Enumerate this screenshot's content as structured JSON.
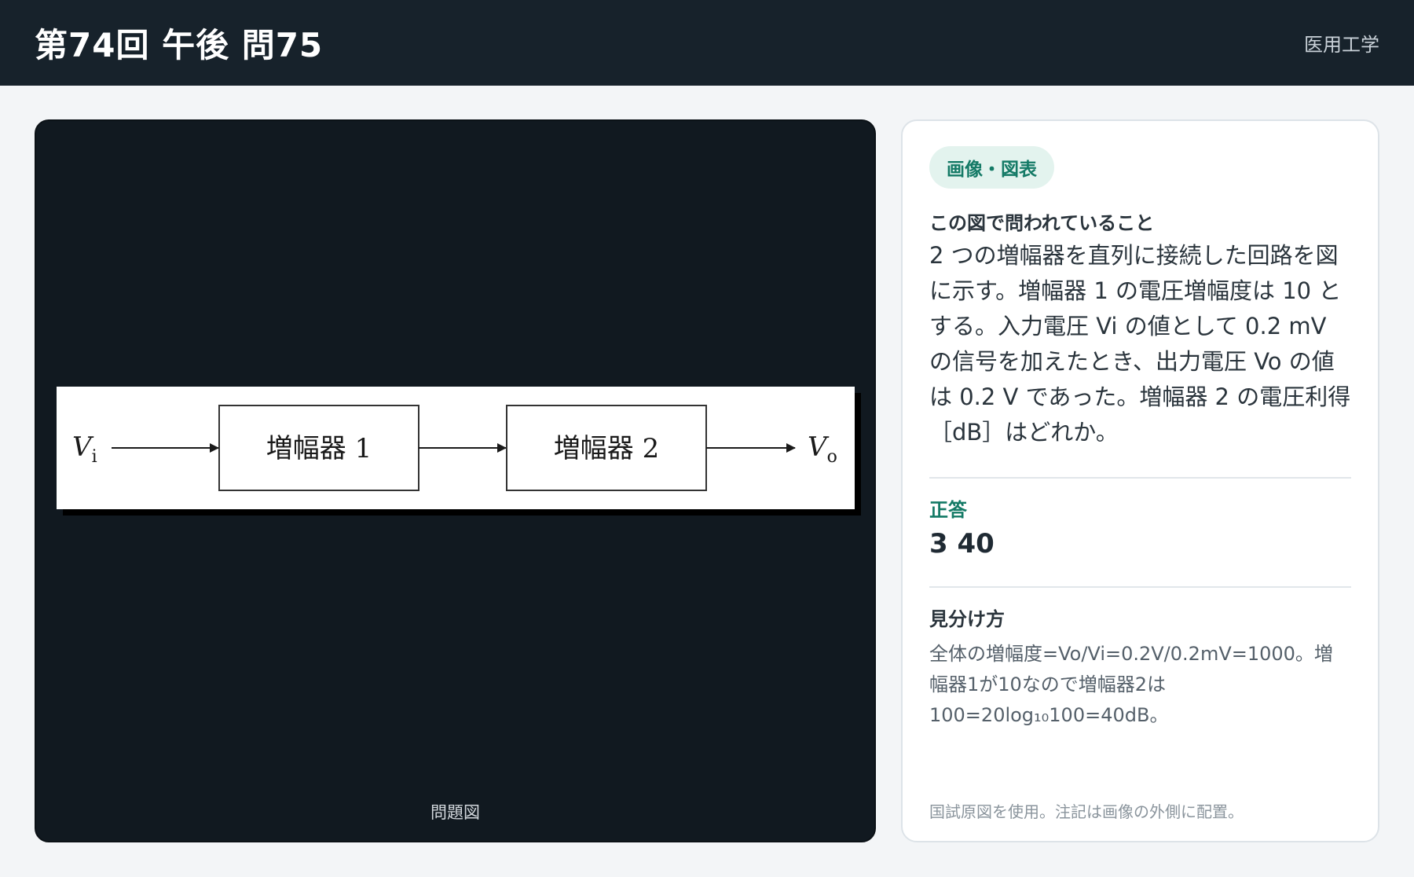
{
  "header": {
    "title": "第74回 午後 問75",
    "subject": "医用工学"
  },
  "figure": {
    "caption": "問題図",
    "diagram": {
      "input_label": "V",
      "input_sub": "i",
      "output_label": "V",
      "output_sub": "o",
      "block1": "増幅器 1",
      "block2": "増幅器 2"
    }
  },
  "card": {
    "tag": "画像・図表",
    "question_heading": "この図で問われていること",
    "question_body": "2 つの増幅器を直列に接続した回路を図に示す。増幅器 1 の電圧増幅度は 10 とする。入力電圧 Vi の値として 0.2 mV の信号を加えたとき、出力電圧 Vo の値は 0.2 V であった。増幅器 2 の電圧利得［dB］はどれか。",
    "answer_label": "正答",
    "answer_value": "3 40",
    "tip_label": "見分け方",
    "tip_body": "全体の増幅度=Vo/Vi=0.2V/0.2mV=1000。増幅器1が10なので増幅器2は100=20log₁₀100=40dB。",
    "footnote": "国試原図を使用。注記は画像の外側に配置。"
  },
  "colors": {
    "header_bg": "#17222b",
    "panel_bg": "#111920",
    "accent": "#147a66",
    "tag_bg": "#e3f3ee"
  }
}
